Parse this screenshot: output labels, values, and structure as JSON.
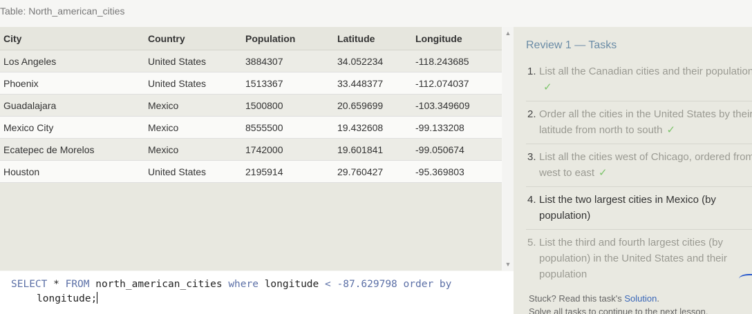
{
  "table_title": "Table: North_american_cities",
  "columns": [
    "City",
    "Country",
    "Population",
    "Latitude",
    "Longitude"
  ],
  "rows": [
    [
      "Los Angeles",
      "United States",
      "3884307",
      "34.052234",
      "-118.243685"
    ],
    [
      "Phoenix",
      "United States",
      "1513367",
      "33.448377",
      "-112.074037"
    ],
    [
      "Guadalajara",
      "Mexico",
      "1500800",
      "20.659699",
      "-103.349609"
    ],
    [
      "Mexico City",
      "Mexico",
      "8555500",
      "19.432608",
      "-99.133208"
    ],
    [
      "Ecatepec de Morelos",
      "Mexico",
      "1742000",
      "19.601841",
      "-99.050674"
    ],
    [
      "Houston",
      "United States",
      "2195914",
      "29.760427",
      "-95.369803"
    ]
  ],
  "editor": {
    "kw_select": "SELECT",
    "star": "*",
    "kw_from": "FROM",
    "table": "north_american_cities",
    "kw_where": "where",
    "field": "longitude",
    "op": "<",
    "value": "-87.629798",
    "kw_order_by": "order by",
    "line2": "longitude;"
  },
  "panel": {
    "title": "Review 1 — Tasks",
    "tasks": [
      {
        "num": "1.",
        "text": "List all the Canadian cities and their population",
        "check": "✓"
      },
      {
        "num": "2.",
        "text": "Order all the cities in the United States by their latitude from north to south",
        "check": "✓"
      },
      {
        "num": "3.",
        "text": "List all the cities west of Chicago, ordered from west to east",
        "check": "✓"
      },
      {
        "num": "4.",
        "text": "List the two largest cities in Mexico (by population)"
      },
      {
        "num": "5.",
        "text": "List the third and fourth largest cities (by population) in the United States and their population"
      }
    ],
    "stuck_prefix": "Stuck? Read this task's",
    "solution_link": "Solution",
    "stuck_suffix": ".",
    "continue_text": "Solve all tasks to continue to the next lesson."
  },
  "scrollbar": {
    "up_icon": "▲",
    "down_icon": "▼"
  }
}
